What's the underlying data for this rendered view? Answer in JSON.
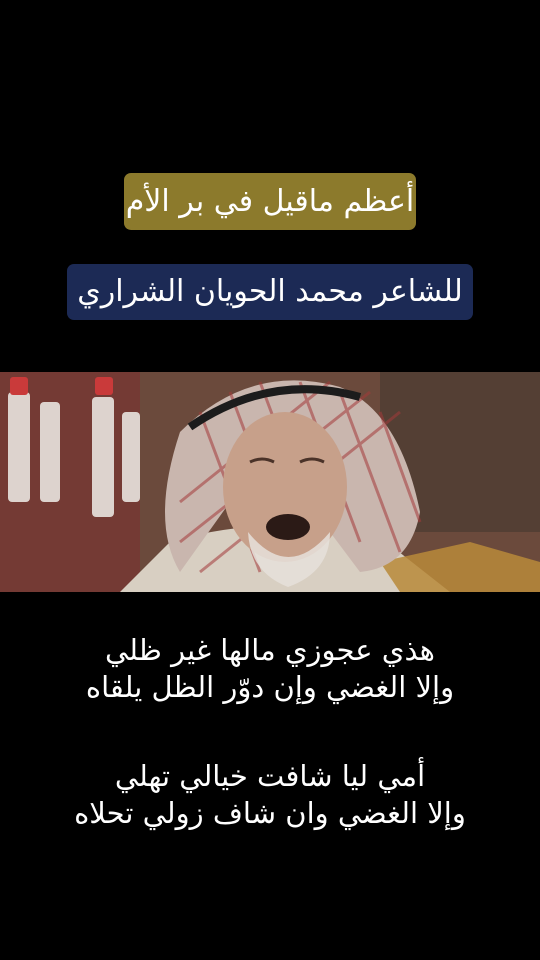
{
  "title": "أعظم ماقيل في بر الأم",
  "subtitle": "للشاعر محمد الحويان الشراري",
  "poem": {
    "stanza1": [
      "هذي عجوزي مالها غير ظلي",
      "وإلا الغضي وإن دوّر الظل يلقاه"
    ],
    "stanza2": [
      "أمي ليا شافت خيالي تهلي",
      "وإلا الغضي وان شاف زولي تحلاه"
    ]
  },
  "colors": {
    "background": "#000000",
    "title_badge": "#8c7a2c",
    "subtitle_badge": "#1c2a55",
    "text": "#ffffff"
  }
}
